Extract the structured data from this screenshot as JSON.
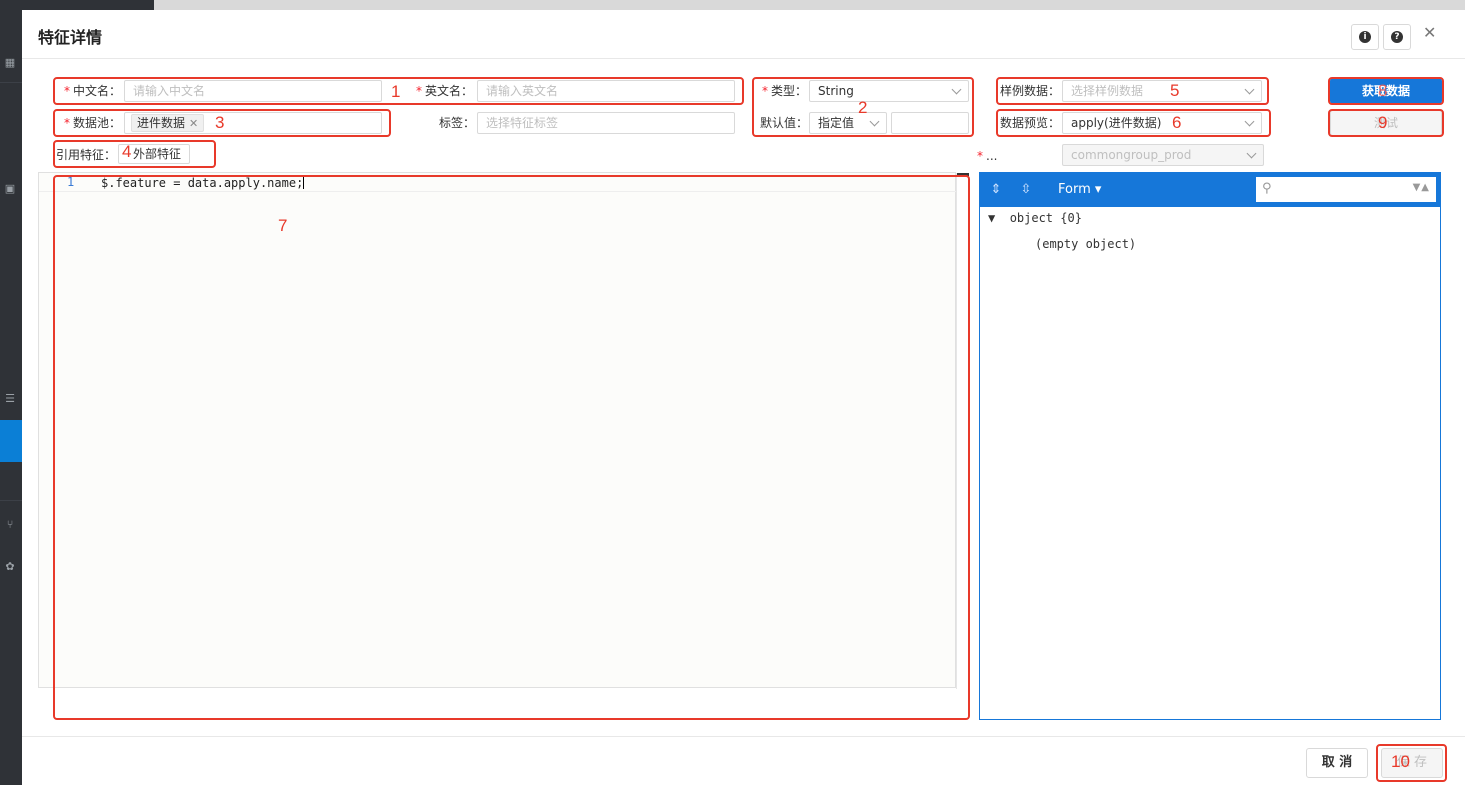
{
  "modal": {
    "title": "特征详情",
    "info_icon": "info-icon",
    "help_icon": "help-icon",
    "close_icon": "close-icon"
  },
  "form": {
    "cn_name": {
      "label": "中文名：",
      "placeholder": "请输入中文名"
    },
    "en_name": {
      "label": "英文名：",
      "placeholder": "请输入英文名"
    },
    "type": {
      "label": "类型：",
      "value": "String"
    },
    "default_value": {
      "label": "默认值：",
      "mode": "指定值",
      "value": ""
    },
    "sample_data": {
      "label": "样例数据：",
      "placeholder": "选择样例数据"
    },
    "data_pool": {
      "label": "数据池：",
      "tag": "进件数据"
    },
    "tags": {
      "label": "标签：",
      "placeholder": "选择特征标签"
    },
    "data_preview": {
      "label": "数据预览：",
      "value": "apply(进件数据)"
    },
    "ref_feature": {
      "label": "引用特征：",
      "tag": "外部特征"
    },
    "env": {
      "label": "...",
      "value": "commongroup_prod"
    }
  },
  "buttons": {
    "fetch_data": "获取数据",
    "test": "测试",
    "cancel": "取 消",
    "save": "保 存"
  },
  "editor": {
    "lines": [
      {
        "no": "1",
        "text": "$.feature = data.apply.name;"
      }
    ]
  },
  "json_viewer": {
    "mode": "Form",
    "root_label": "object {0}",
    "empty_text": "(empty object)"
  },
  "annotations": [
    "1",
    "2",
    "3",
    "4",
    "5",
    "6",
    "7",
    "8",
    "9",
    "10"
  ]
}
